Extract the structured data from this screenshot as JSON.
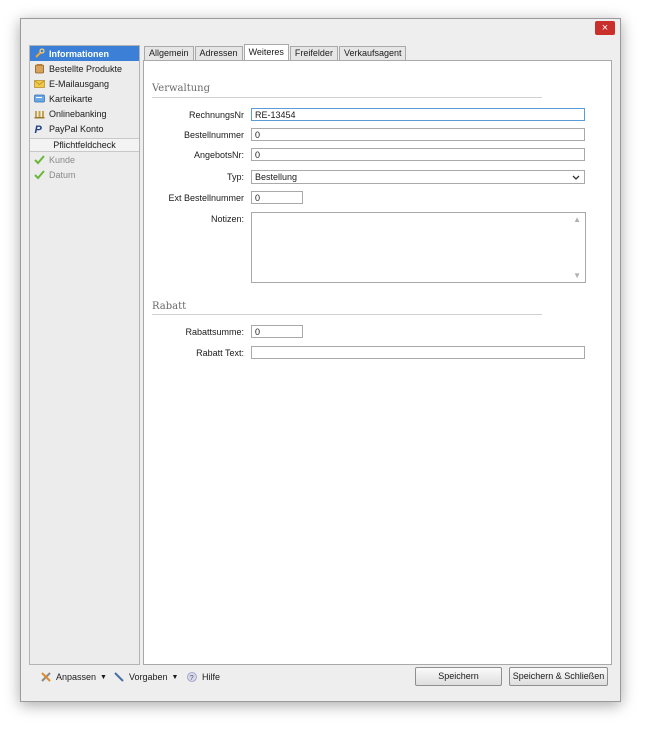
{
  "window": {
    "close_label": "×"
  },
  "sidebar": {
    "items": [
      {
        "label": "Informationen",
        "icon": "wrench-icon"
      },
      {
        "label": "Bestellte Produkte",
        "icon": "box-icon"
      },
      {
        "label": "E-Mailausgang",
        "icon": "mail-icon"
      },
      {
        "label": "Karteikarte",
        "icon": "card-icon"
      },
      {
        "label": "Onlinebanking",
        "icon": "bank-icon"
      },
      {
        "label": "PayPal Konto",
        "icon": "paypal-icon"
      }
    ],
    "check_title": "Pflichtfeldcheck",
    "check_items": [
      {
        "label": "Kunde",
        "icon": "checkmark-icon"
      },
      {
        "label": "Datum",
        "icon": "checkmark-icon"
      }
    ]
  },
  "tabs": [
    "Allgemein",
    "Adressen",
    "Weiteres",
    "Freifelder",
    "Verkaufsagent"
  ],
  "verwaltung": {
    "title": "Verwaltung",
    "rechnungsnr_label": "RechnungsNr",
    "rechnungsnr_value": "RE-13454",
    "bestellnummer_label": "Bestellnummer",
    "bestellnummer_value": "0",
    "angebotsnr_label": "AngebotsNr:",
    "angebotsnr_value": "0",
    "typ_label": "Typ:",
    "typ_value": "Bestellung",
    "ext_label": "Ext Bestellnummer",
    "ext_value": "0",
    "notizen_label": "Notizen:",
    "notizen_value": ""
  },
  "rabatt": {
    "title": "Rabatt",
    "summe_label": "Rabattsumme:",
    "summe_value": "0",
    "text_label": "Rabatt Text:",
    "text_value": ""
  },
  "footer": {
    "anpassen": "Anpassen",
    "vorgaben": "Vorgaben",
    "hilfe": "Hilfe",
    "speichern": "Speichern",
    "speichern_schliessen": "Speichern & Schließen"
  }
}
